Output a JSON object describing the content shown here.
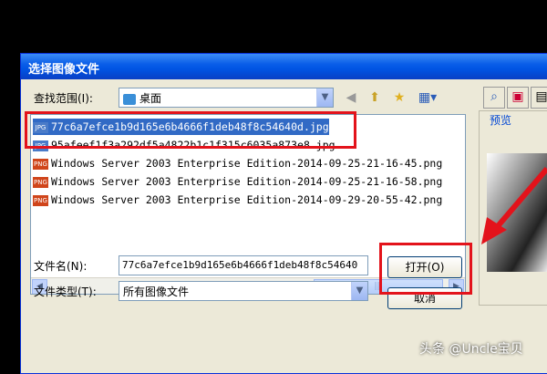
{
  "dialog": {
    "title": "选择图像文件",
    "lookin_label": "查找范围(I):",
    "lookin_value": "桌面",
    "preview_label": "预览",
    "filename_label": "文件名(N):",
    "filename_value": "77c6a7efce1b9d165e6b4666f1deb48f8c54640",
    "filetype_label": "文件类型(T):",
    "filetype_value": "所有图像文件",
    "open_button": "打开(O)",
    "cancel_button": "取消"
  },
  "files": [
    {
      "name": "77c6a7efce1b9d165e6b4666f1deb48f8c54640d.jpg",
      "type": "JPG",
      "selected": true
    },
    {
      "name": "95afeef1f3a292df5a4822b1c1f315c6035a873e8.jpg",
      "type": "JPG",
      "selected": false
    },
    {
      "name": "Windows Server 2003 Enterprise Edition-2014-09-25-21-16-45.png",
      "type": "PNG",
      "selected": false
    },
    {
      "name": "Windows Server 2003 Enterprise Edition-2014-09-25-21-16-58.png",
      "type": "PNG",
      "selected": false
    },
    {
      "name": "Windows Server 2003 Enterprise Edition-2014-09-29-20-55-42.png",
      "type": "PNG",
      "selected": false
    }
  ],
  "watermark": "头条 @Uncle宝贝",
  "colors": {
    "highlight": "#e3131b",
    "selection": "#316ac5",
    "titlebar": "#0054e3"
  }
}
